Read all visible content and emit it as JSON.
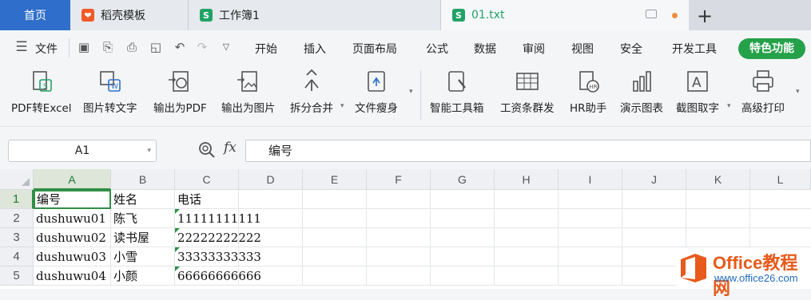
{
  "tabs": {
    "home": "首页",
    "template": "稻壳模板",
    "workbook": "工作簿1",
    "active": "01.txt"
  },
  "menu": {
    "file": "文件",
    "items": [
      "开始",
      "插入",
      "页面布局",
      "公式",
      "数据",
      "审阅",
      "视图",
      "安全",
      "开发工具"
    ],
    "special": "特色功能"
  },
  "ribbon": {
    "buttons": [
      "PDF转Excel",
      "图片转文字",
      "输出为PDF",
      "输出为图片",
      "拆分合并",
      "文件瘦身",
      "智能工具箱",
      "工资条群发",
      "HR助手",
      "演示图表",
      "截图取字",
      "高级打印"
    ]
  },
  "formula": {
    "cell_ref": "A1",
    "fx_label": "fx",
    "content": "编号"
  },
  "sheet": {
    "columns": [
      "A",
      "B",
      "C",
      "D",
      "E",
      "F",
      "G",
      "H",
      "I",
      "J",
      "K",
      "L"
    ],
    "row_numbers": [
      "1",
      "2",
      "3",
      "4",
      "5"
    ],
    "rows": [
      [
        "编号",
        "姓名",
        "电话"
      ],
      [
        "dushuwu01",
        "陈飞",
        "11111111111"
      ],
      [
        "dushuwu02",
        "读书屋",
        "22222222222"
      ],
      [
        "dushuwu03",
        "小雪",
        "33333333333"
      ],
      [
        "dushuwu04",
        "小颜",
        "66666666666"
      ]
    ]
  },
  "watermark": {
    "title": "Office教程网",
    "url": "www.office26.com"
  },
  "colors": {
    "accent_green": "#25a14a",
    "home_tab": "#2f6fcb",
    "selection": "#2f8f46"
  }
}
